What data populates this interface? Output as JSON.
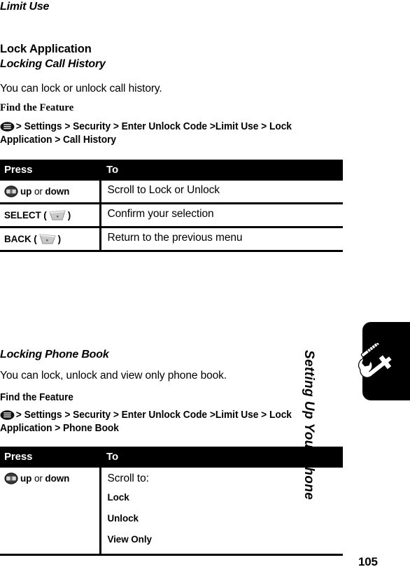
{
  "document": {
    "running_head": "Limit Use",
    "page_number": "105",
    "side_tab_label": "Setting Up Your Phone",
    "side_tab_icon": "wrench-screwdriver-icon"
  },
  "sections": [
    {
      "heading": "Lock Application",
      "subheading": "Locking Call History",
      "intro": "You can lock or unlock call history.",
      "find_the_feature_label": "Find the Feature",
      "nav_path_icon": "menu-key-icon",
      "nav_path": "> Settings > Security > Enter Unlock Code >Limit Use > Lock Application > Call History",
      "table": {
        "columns": [
          "Press",
          "To"
        ],
        "rows": [
          {
            "press_icon": "navigation-key-icon",
            "press_bold_1": "up",
            "press_plain": "or",
            "press_bold_2": "down",
            "to": "Scroll to Lock or Unlock"
          },
          {
            "press_label": "SELECT",
            "press_icon": "right-soft-key-icon",
            "to": "Confirm your selection"
          },
          {
            "press_label": "BACK",
            "press_icon": "left-soft-key-icon",
            "to": "Return to the previous menu"
          }
        ]
      }
    },
    {
      "subheading": "Locking Phone Book",
      "intro": "You can lock, unlock and view only phone book.",
      "find_the_feature_label": "Find the Feature",
      "nav_path_icon": "menu-key-icon",
      "nav_path": "> Settings > Security > Enter Unlock Code >Limit Use > Lock Application > Phone Book",
      "table": {
        "columns": [
          "Press",
          "To"
        ],
        "rows": [
          {
            "press_icon": "navigation-key-icon",
            "press_bold_1": "up",
            "press_plain": "or",
            "press_bold_2": "down",
            "to_lines": [
              "Scroll to:",
              "Lock",
              "Unlock",
              "View Only"
            ]
          }
        ]
      }
    }
  ],
  "colors": {
    "table_header_bg": "#000000",
    "table_header_fg": "#ffffff",
    "rule": "#000000",
    "side_tab_bg": "#000000",
    "text": "#000000"
  }
}
